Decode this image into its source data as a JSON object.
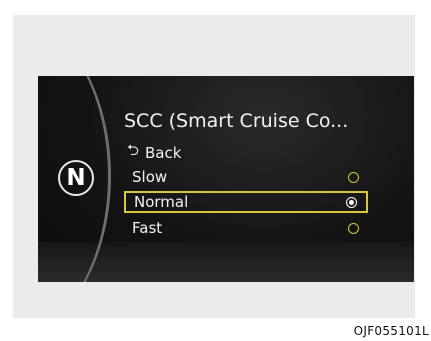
{
  "display": {
    "gear": "N",
    "title": "SCC (Smart Cruise Co...",
    "back_label": "Back",
    "back_icon": "return-arrow-icon",
    "options": [
      {
        "label": "Slow",
        "selected": false
      },
      {
        "label": "Normal",
        "selected": true
      },
      {
        "label": "Fast",
        "selected": false
      }
    ],
    "highlight_color": "#d9c93a"
  },
  "caption": {
    "code": "OJF055101L"
  }
}
